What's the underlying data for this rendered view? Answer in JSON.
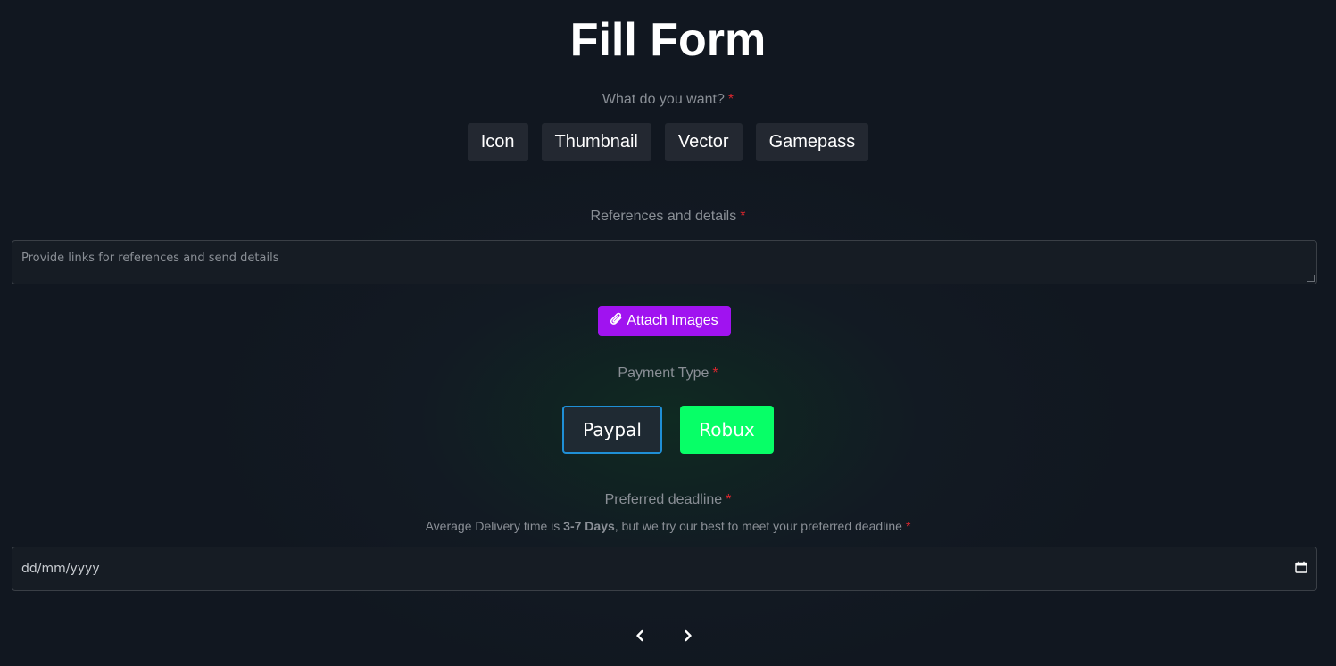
{
  "page": {
    "title": "Fill Form"
  },
  "want": {
    "label": "What do you want?",
    "required_mark": "*",
    "options": [
      "Icon",
      "Thumbnail",
      "Vector",
      "Gamepass"
    ]
  },
  "references": {
    "label": "References and details",
    "required_mark": "*",
    "placeholder": "Provide links for references and send details",
    "value": ""
  },
  "attach": {
    "label": "Attach Images",
    "icon": "paperclip-icon",
    "color": "#a013f0"
  },
  "payment": {
    "label": "Payment Type",
    "required_mark": "*",
    "paypal_label": "Paypal",
    "robux_label": "Robux",
    "paypal_border_color": "#1f8fd6",
    "robux_color": "#07ff67"
  },
  "deadline": {
    "label": "Preferred deadline",
    "required_mark": "*",
    "note_prefix": "Average Delivery time is",
    "note_bold": "3-7 Days",
    "note_suffix": ", but we try our best to meet your preferred deadline",
    "note_required_mark": "*",
    "placeholder": "dd/mm/yyyy",
    "icon": "calendar-icon"
  },
  "navigation": {
    "prev_icon": "chevron-left-icon",
    "next_icon": "chevron-right-icon"
  }
}
